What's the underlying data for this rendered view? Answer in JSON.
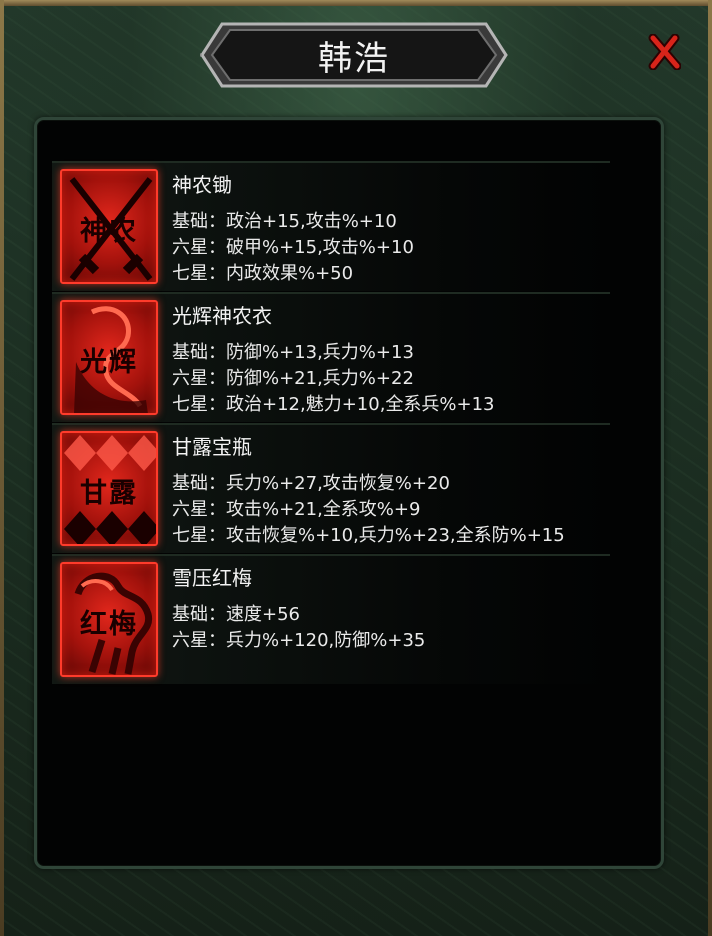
{
  "title": "韩浩",
  "close_label": "X",
  "colors": {
    "accent": "#ff3b2b",
    "panel_bg": "#020303",
    "frame_green": "#1b2a1e"
  },
  "items": [
    {
      "name": "神农锄",
      "icon_text": "神农",
      "icon": "crossed-hoes-icon",
      "stats": [
        "基础：政治+15,攻击%+10",
        "六星：破甲%+15,攻击%+10",
        "七星：内政效果%+50"
      ]
    },
    {
      "name": "光辉神农衣",
      "icon_text": "光辉",
      "icon": "armor-robe-icon",
      "stats": [
        "基础：防御%+13,兵力%+13",
        "六星：防御%+21,兵力%+22",
        "七星：政治+12,魅力+10,全系兵%+13"
      ]
    },
    {
      "name": "甘露宝瓶",
      "icon_text": "甘露",
      "icon": "diamond-vase-icon",
      "stats": [
        "基础：兵力%+27,攻击恢复%+20",
        "六星：攻击%+21,全系攻%+9",
        "七星：攻击恢复%+10,兵力%+23,全系防%+15"
      ]
    },
    {
      "name": "雪压红梅",
      "icon_text": "红梅",
      "icon": "horse-icon",
      "stats": [
        "基础：速度+56",
        "六星：兵力%+120,防御%+35"
      ]
    }
  ]
}
